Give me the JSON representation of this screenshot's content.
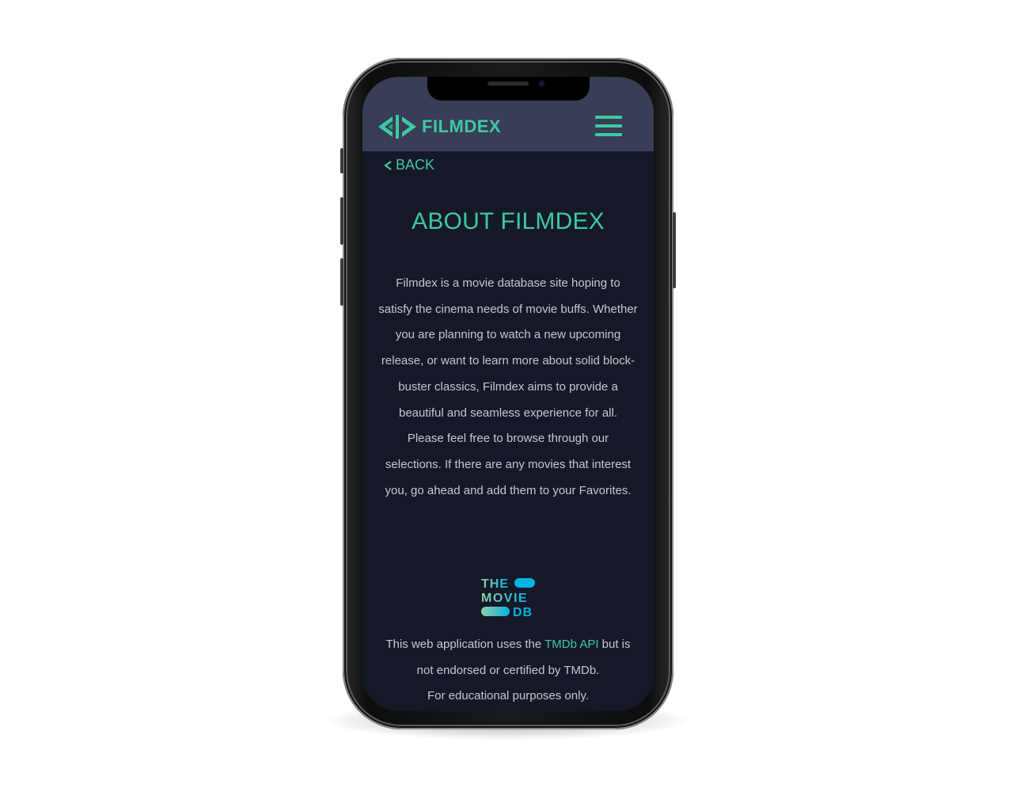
{
  "nav": {
    "logo_text": "FILMDEX",
    "menu_icon": "hamburger-menu-icon"
  },
  "back": {
    "label": "BACK",
    "icon": "chevron-left-icon"
  },
  "about": {
    "title": "ABOUT FILMDEX",
    "paragraph1": "Filmdex is a movie database site hoping to satisfy the cinema needs of movie buffs. Whether you are planning to watch a new upcoming release, or want to learn more about solid block-buster classics, Filmdex aims to provide a beautiful and seamless experience for all.",
    "paragraph2": "Please feel free to browse through our selections. If there are any movies that interest you, go ahead and add them to your Favorites."
  },
  "tmdb_logo": {
    "line1": "THE",
    "line2": "MOVIE",
    "line3": "DB"
  },
  "footer": {
    "prefix": "This web application uses the ",
    "link": "TMDb API",
    "suffix": " but is not endorsed or certified by TMDb.",
    "note": "For educational purposes only."
  },
  "colors": {
    "accent": "#3cc9a4",
    "navbar": "#393d55",
    "background": "#151827",
    "text": "#c5c7d2"
  }
}
